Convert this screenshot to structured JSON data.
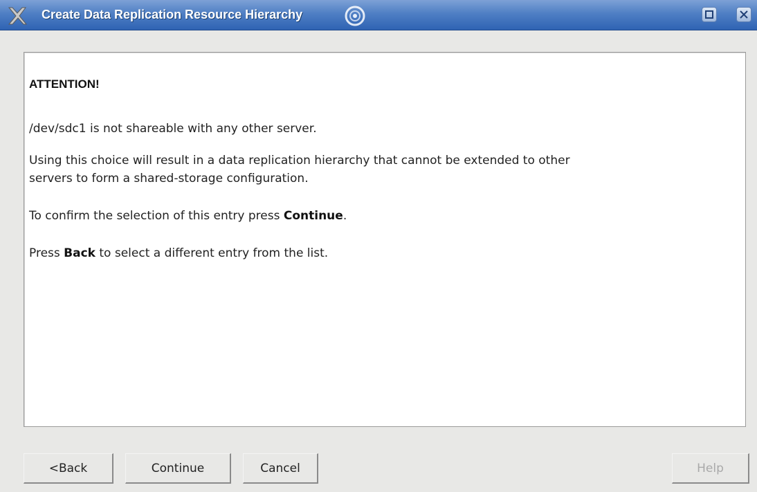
{
  "window": {
    "title": "Create Data Replication Resource Hierarchy",
    "icons": {
      "app": "x-logo-icon",
      "busy": "busy-spinner-icon",
      "maximize": "maximize-icon",
      "close": "close-icon"
    },
    "colors": {
      "titlebar": "#4f7fc4",
      "panel_bg": "#ffffff",
      "dialog_bg": "#e8e8e6"
    }
  },
  "message": {
    "heading": "ATTENTION!",
    "line1": "/dev/sdc1 is not shareable with any other server.",
    "line2a": "Using this choice will result in a data replication hierarchy that cannot be extended to other",
    "line2b": "servers to form a shared-storage configuration.",
    "line3_prefix": "To confirm the selection of this entry press ",
    "line3_bold": "Continue",
    "line3_suffix": ".",
    "line4_prefix": "Press ",
    "line4_bold": "Back",
    "line4_suffix": " to select a different entry from the list."
  },
  "buttons": {
    "back": "<Back",
    "continue": "Continue",
    "cancel": "Cancel",
    "help": "Help",
    "help_enabled": false
  }
}
